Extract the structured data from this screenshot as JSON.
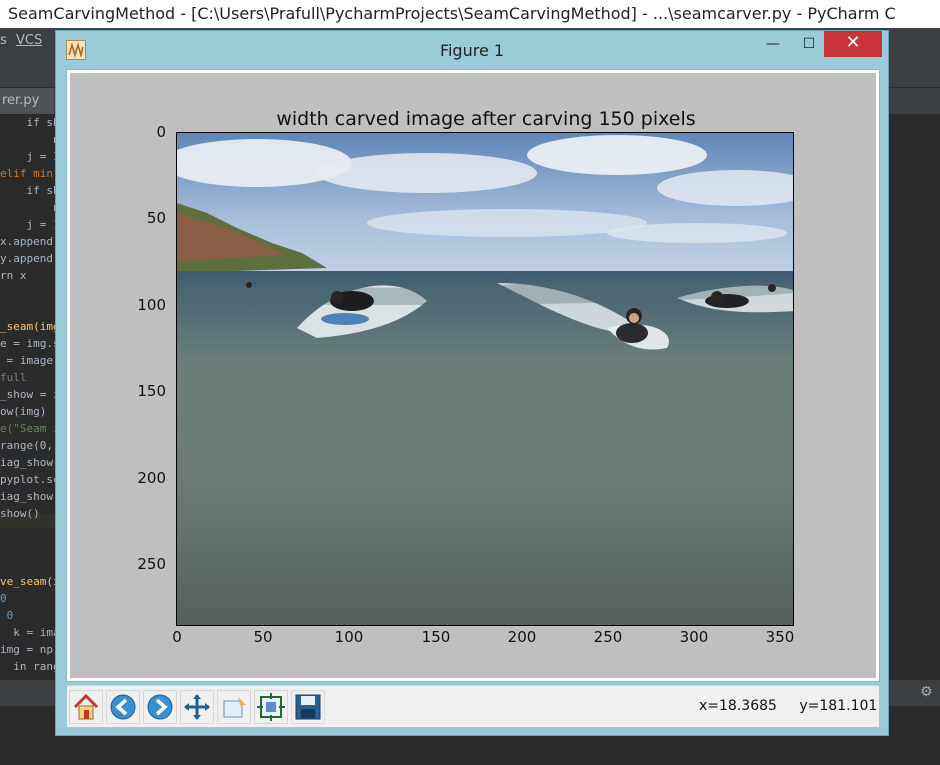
{
  "pycharm": {
    "title": "SeamCarvingMethod - [C:\\Users\\Prafull\\PycharmProjects\\SeamCarvingMethod] - ...\\seamcarver.py - PyCharm C",
    "menu": [
      "s",
      "VCS"
    ],
    "tab": "rer.py",
    "tab_close": "×",
    "code_lines": [
      {
        "text": "    if sh",
        "cls": ""
      },
      {
        "text": "        n",
        "cls": ""
      },
      {
        "text": "    j = 1",
        "cls": ""
      },
      {
        "text": "elif min",
        "cls": "kw"
      },
      {
        "text": "    if sh",
        "cls": ""
      },
      {
        "text": "        n",
        "cls": ""
      },
      {
        "text": "    j = 1",
        "cls": ""
      },
      {
        "text": "x.append",
        "cls": ""
      },
      {
        "text": "y.append",
        "cls": ""
      },
      {
        "text": "rn x",
        "cls": ""
      },
      {
        "text": "",
        "cls": ""
      },
      {
        "text": "",
        "cls": ""
      },
      {
        "text": "_seam(img",
        "cls": "fn"
      },
      {
        "text": "e = img.s",
        "cls": ""
      },
      {
        "text": " = image",
        "cls": ""
      },
      {
        "text": "full",
        "cls": "cm"
      },
      {
        "text": "_show = i",
        "cls": ""
      },
      {
        "text": "ow(img)",
        "cls": ""
      },
      {
        "text": "e(\"Seam i",
        "cls": "st"
      },
      {
        "text": "range(0,",
        "cls": ""
      },
      {
        "text": "iag_show",
        "cls": ""
      },
      {
        "text": "pyplot.sc",
        "cls": ""
      },
      {
        "text": "iag_show",
        "cls": ""
      },
      {
        "text": "show()",
        "cls": ""
      },
      {
        "text": "",
        "cls": ""
      },
      {
        "text": "",
        "cls": ""
      },
      {
        "text": "",
        "cls": ""
      },
      {
        "text": "ve_seam(i",
        "cls": "fn"
      },
      {
        "text": "0",
        "cls": "nm"
      },
      {
        "text": " 0",
        "cls": "nm"
      },
      {
        "text": "  k = ima",
        "cls": ""
      },
      {
        "text": "img = np.",
        "cls": ""
      },
      {
        "text": "  in rang",
        "cls": ""
      }
    ]
  },
  "figure": {
    "title": "Figure 1",
    "window_min": "—",
    "window_max": "☐",
    "window_close": "✕",
    "coords": {
      "x": "x=18.3685",
      "y": "y=181.101"
    },
    "toolbar": [
      {
        "name": "home-icon",
        "label": "home"
      },
      {
        "name": "back-icon",
        "label": "back"
      },
      {
        "name": "forward-icon",
        "label": "forward"
      },
      {
        "name": "pan-icon",
        "label": "pan"
      },
      {
        "name": "zoom-icon",
        "label": "zoom"
      },
      {
        "name": "configure-subplots-icon",
        "label": "subplots"
      },
      {
        "name": "save-icon",
        "label": "save"
      }
    ]
  },
  "chart_data": {
    "type": "image",
    "title": "width carved image after carving 150 pixels",
    "xlabel": "",
    "ylabel": "",
    "xlim": [
      0,
      358
    ],
    "ylim": [
      285,
      0
    ],
    "xticks": [
      0,
      50,
      100,
      150,
      200,
      250,
      300,
      350
    ],
    "yticks": [
      0,
      50,
      100,
      150,
      200,
      250
    ],
    "grid": false
  }
}
